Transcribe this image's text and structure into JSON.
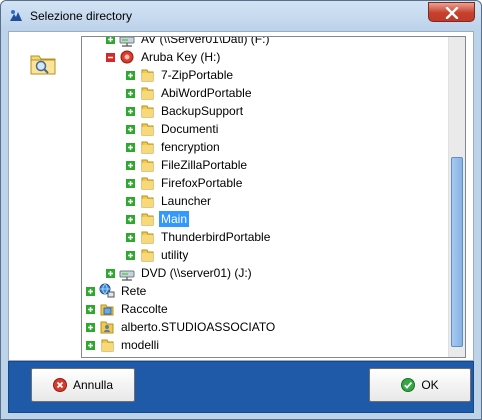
{
  "window": {
    "title": "Selezione directory"
  },
  "tree": {
    "nodes": [
      {
        "label": "AV (\\\\Server01\\Dati) (F:)",
        "icon": "network-drive-icon",
        "expander": "plus"
      },
      {
        "label": "Aruba Key (H:)",
        "icon": "removable-drive-icon",
        "expander": "minus"
      },
      {
        "label": "7-ZipPortable",
        "icon": "folder-icon",
        "expander": "plus"
      },
      {
        "label": "AbiWordPortable",
        "icon": "folder-icon",
        "expander": "plus"
      },
      {
        "label": "BackupSupport",
        "icon": "folder-icon",
        "expander": "plus"
      },
      {
        "label": "Documenti",
        "icon": "folder-icon",
        "expander": "plus"
      },
      {
        "label": "fencryption",
        "icon": "folder-icon",
        "expander": "plus"
      },
      {
        "label": "FileZillaPortable",
        "icon": "folder-icon",
        "expander": "plus"
      },
      {
        "label": "FirefoxPortable",
        "icon": "folder-icon",
        "expander": "plus"
      },
      {
        "label": "Launcher",
        "icon": "folder-icon",
        "expander": "plus"
      },
      {
        "label": "Main",
        "icon": "folder-icon",
        "expander": "plus",
        "selected": true
      },
      {
        "label": "ThunderbirdPortable",
        "icon": "folder-icon",
        "expander": "plus"
      },
      {
        "label": "utility",
        "icon": "folder-icon",
        "expander": "plus"
      },
      {
        "label": "DVD (\\\\server01) (J:)",
        "icon": "network-drive-icon",
        "expander": "plus"
      },
      {
        "label": "Rete",
        "icon": "network-icon",
        "expander": "plus"
      },
      {
        "label": "Raccolte",
        "icon": "libraries-icon",
        "expander": "plus"
      },
      {
        "label": "alberto.STUDIOASSOCIATO",
        "icon": "user-folder-icon",
        "expander": "plus"
      },
      {
        "label": "modelli",
        "icon": "folder-icon",
        "expander": "plus"
      }
    ]
  },
  "buttons": {
    "cancel_label": "Annulla",
    "ok_label": "OK"
  },
  "colors": {
    "selection": "#3399ff",
    "footer": "#1f5aa8",
    "close_button": "#c7412b"
  }
}
